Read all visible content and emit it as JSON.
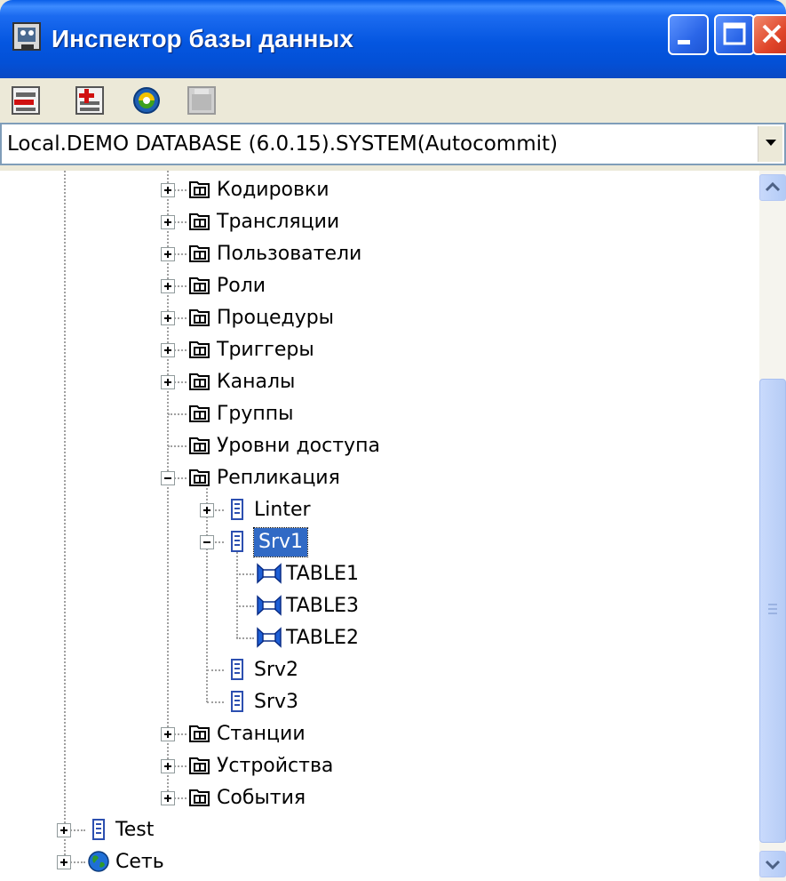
{
  "window": {
    "title": "Инспектор базы данных"
  },
  "titlebar_buttons": [
    "minimize-icon",
    "maximize-icon",
    "close-icon"
  ],
  "toolbar": {
    "tools": [
      "disconnect-icon",
      "connect-icon",
      "refresh-icon",
      "properties-icon"
    ]
  },
  "connection": {
    "value": "Local.DEMO DATABASE (6.0.15).SYSTEM(Autocommit)"
  },
  "tree": {
    "items": [
      {
        "label": "Кодировки",
        "icon": "folder-icon"
      },
      {
        "label": "Трансляции",
        "icon": "folder-icon"
      },
      {
        "label": "Пользователи",
        "icon": "folder-icon"
      },
      {
        "label": "Роли",
        "icon": "folder-icon"
      },
      {
        "label": "Процедуры",
        "icon": "folder-icon"
      },
      {
        "label": "Триггеры",
        "icon": "folder-icon"
      },
      {
        "label": "Каналы",
        "icon": "folder-icon"
      },
      {
        "label": "Группы",
        "icon": "folder-icon"
      },
      {
        "label": "Уровни доступа",
        "icon": "folder-icon"
      },
      {
        "label": "Репликация",
        "icon": "folder-icon"
      },
      {
        "label": "Linter",
        "icon": "server-icon"
      },
      {
        "label": "Srv1",
        "icon": "server-icon"
      },
      {
        "label": "TABLE1",
        "icon": "replication-table-icon"
      },
      {
        "label": "TABLE3",
        "icon": "replication-table-icon"
      },
      {
        "label": "TABLE2",
        "icon": "replication-table-icon"
      },
      {
        "label": "Srv2",
        "icon": "server-icon"
      },
      {
        "label": "Srv3",
        "icon": "server-icon"
      },
      {
        "label": "Станции",
        "icon": "folder-icon"
      },
      {
        "label": "Устройства",
        "icon": "folder-icon"
      },
      {
        "label": "События",
        "icon": "folder-icon"
      },
      {
        "label": "Test",
        "icon": "server-icon"
      },
      {
        "label": "Сеть",
        "icon": "globe-icon"
      }
    ],
    "selected": "Srv1"
  },
  "colors": {
    "selection": "#316ac5",
    "titlebar": "#0456e0",
    "close": "#e0452a"
  }
}
